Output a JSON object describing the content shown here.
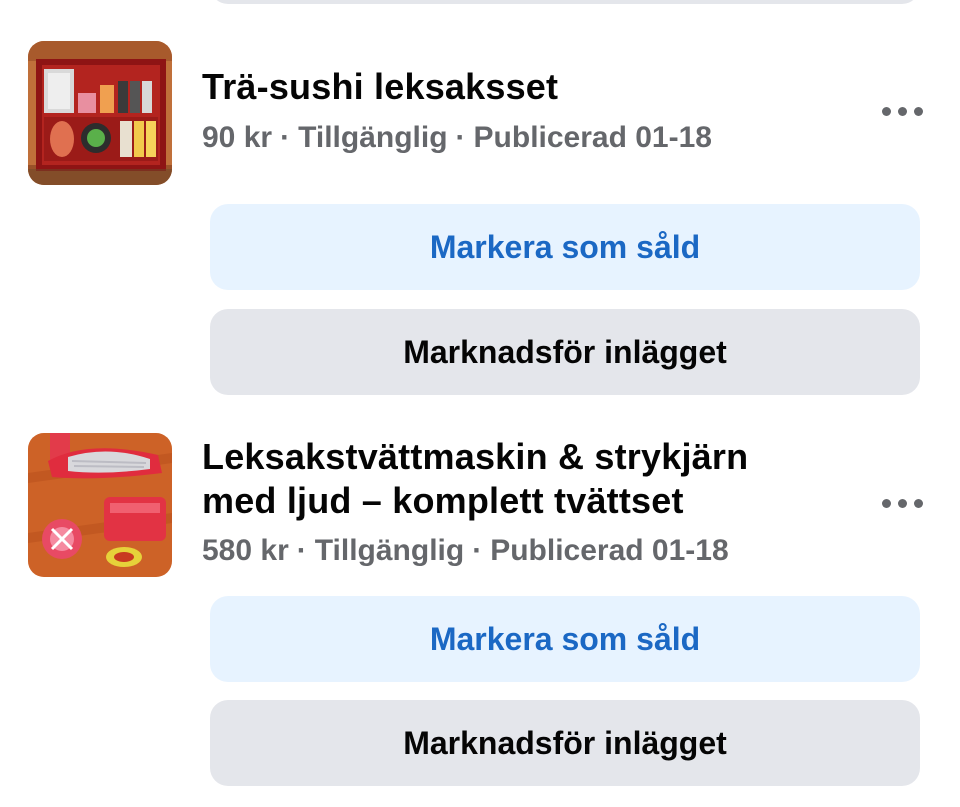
{
  "listings": [
    {
      "title": "Trä-sushi leksaksset",
      "price": "90 kr",
      "status": "Tillgänglig",
      "published": "Publicerad 01-18",
      "separator": "·",
      "thumbnail_icon": "sushi-toy-set-photo",
      "more_icon": "more-options-icon",
      "primary_action": "Markera som såld",
      "secondary_action": "Marknadsför inlägget"
    },
    {
      "title_line1": "Leksakstvättmaskin & strykjärn",
      "title_line2": "med ljud – komplett tvättset",
      "price": "580 kr",
      "status": "Tillgänglig",
      "published": "Publicerad 01-18",
      "separator": "·",
      "thumbnail_icon": "toy-laundry-set-photo",
      "more_icon": "more-options-icon",
      "primary_action": "Markera som såld",
      "secondary_action": "Marknadsför inlägget"
    }
  ],
  "colors": {
    "primary_button_bg": "#e7f3ff",
    "primary_button_text": "#1b68c4",
    "secondary_button_bg": "#e4e6eb",
    "secondary_button_text": "#050505",
    "meta_text": "#65676b"
  }
}
